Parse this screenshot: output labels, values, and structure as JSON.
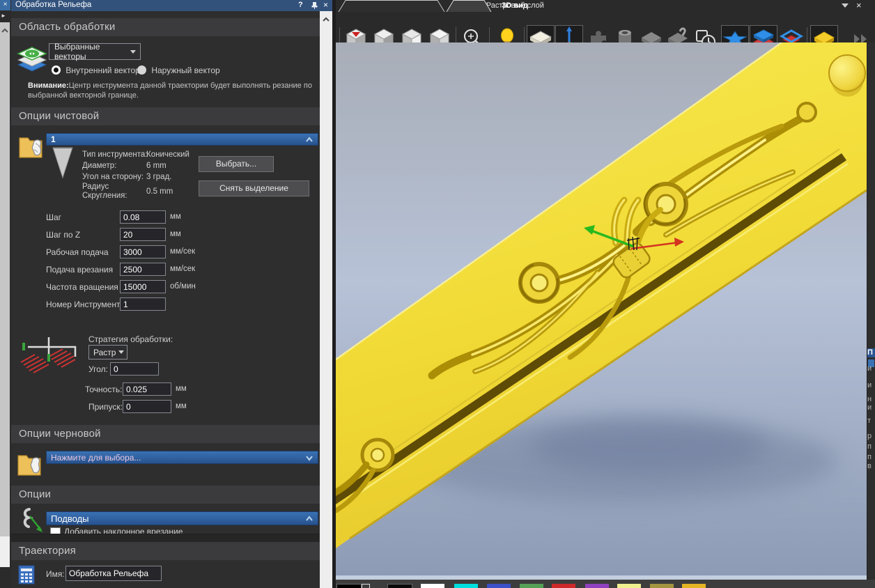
{
  "left_rail": {
    "close": "×",
    "expand": "►"
  },
  "panel": {
    "title": "Обработка Рельефа",
    "help": "?",
    "close": "×",
    "section_area": "Область обработки",
    "vector_source": "Выбранные векторы",
    "radio_inner": "Внутренний вектор",
    "radio_outer": "Наружный вектор",
    "warning_bold": "Внимание:",
    "warning_line1": "Центр инструмента данной траектории будет выполнять резание по",
    "warning_line2": "выбранной векторной границе.",
    "section_finish": "Опции чистовой",
    "tool_group": "1",
    "tool_info": [
      {
        "label": "Тип инструмента:",
        "value": "Конический"
      },
      {
        "label": "Диаметр:",
        "value": "6 mm"
      },
      {
        "label": "Угол на сторону:",
        "value": "3 град."
      },
      {
        "label": "Радиус Скругления:",
        "value": "0.5 mm"
      }
    ],
    "btn_select": "Выбрать...",
    "btn_deselect": "Снять выделение",
    "params": [
      {
        "label": "Шаг",
        "value": "0.08",
        "unit": "мм"
      },
      {
        "label": "Шаг по Z",
        "value": "20",
        "unit": "мм"
      },
      {
        "label": "Рабочая подача",
        "value": "3000",
        "unit": "мм/сек"
      },
      {
        "label": "Подача врезания",
        "value": "2500",
        "unit": "мм/сек"
      },
      {
        "label": "Частота вращения",
        "value": "15000",
        "unit": "об/мин"
      },
      {
        "label": "Номер Инструмента",
        "value": "1",
        "unit": ""
      }
    ],
    "strategy_label": "Стратегия обработки:",
    "strategy_value": "Растр",
    "angle_label": "Угол:",
    "angle_value": "0",
    "tolerance_label": "Точность:",
    "tolerance_value": "0.025",
    "tolerance_unit": "мм",
    "allowance_label": "Припуск:",
    "allowance_value": "0",
    "allowance_unit": "мм",
    "section_rough": "Опции черновой",
    "rough_prompt": "Нажмите для выбора...",
    "section_options": "Опции",
    "leads_header": "Подводы",
    "leads_checkbox": "Добавить наклонное врезание",
    "section_toolpath": "Траектория",
    "name_label": "Имя:",
    "name_value": "Обработка Рельефа"
  },
  "viewport": {
    "tab_2d": "2D Вид - Растровый слой",
    "tab_3d": "3D вид",
    "close": "×",
    "toolbar_icon_names": [
      "view-down-cube",
      "iso-view-cube-1",
      "iso-view-cube-2",
      "iso-view-cube-3",
      "zoom-tool",
      "light-toggle",
      "draw-plane-toggle",
      "origin-axes-toggle",
      "plugin-disabled",
      "material-block-disabled",
      "relief-plane-disabled",
      "simulate-disabled",
      "copy-timer",
      "vector-star-layer",
      "stacked-layers",
      "active-layer-outline",
      "relief-layer-yellow",
      "expand-more-disabled"
    ]
  },
  "right_strip": {
    "items": [
      "П",
      "и",
      "и",
      "н",
      "и",
      "т",
      "р",
      "п",
      "п",
      "в"
    ]
  },
  "palette": {
    "colors": [
      "#000000",
      "#0a0a0a",
      "#ffffff",
      "#00dede",
      "#3c50c8",
      "#55a055",
      "#cc2a2a",
      "#8f41bd",
      "#efef8f",
      "#a39440",
      "#e3b424"
    ]
  }
}
